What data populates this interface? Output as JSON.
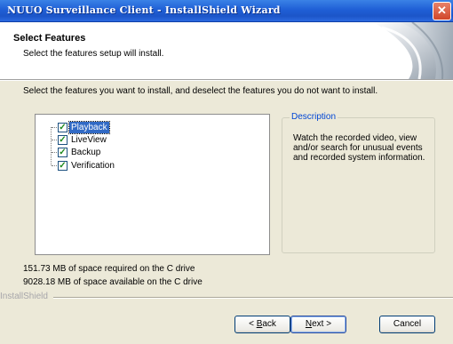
{
  "window": {
    "title": "NUUO Surveillance Client - InstallShield Wizard",
    "close_glyph": "✕"
  },
  "header": {
    "title": "Select Features",
    "subtitle": "Select the features setup will install."
  },
  "instruction": "Select the features you want to install, and deselect the features you do not want to install.",
  "features": [
    {
      "label": "Playback",
      "checked": true,
      "selected": true
    },
    {
      "label": "LiveView",
      "checked": true,
      "selected": false
    },
    {
      "label": "Backup",
      "checked": true,
      "selected": false
    },
    {
      "label": "Verification",
      "checked": true,
      "selected": false
    }
  ],
  "description": {
    "legend": "Description",
    "text": "Watch the recorded video, view and/or search for unusual events and recorded system information."
  },
  "space": {
    "required": "151.73 MB of space required on the C drive",
    "available": "9028.18 MB of space available on the C drive"
  },
  "footer": {
    "brand": "InstallShield"
  },
  "buttons": {
    "back_prefix": "< ",
    "back_mnemonic": "B",
    "back_rest": "ack",
    "next_mnemonic": "N",
    "next_rest": "ext >",
    "cancel": "Cancel"
  },
  "colors": {
    "titlebar": "#1f5fd6",
    "selection": "#316ac5",
    "legend": "#0046d5"
  }
}
